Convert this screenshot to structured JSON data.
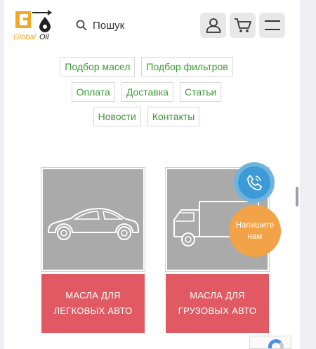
{
  "header": {
    "logo_text_a": "Global",
    "logo_text_b": "Oil",
    "search_placeholder": "Пошук"
  },
  "nav_rows": [
    [
      "Подбор масел",
      "Подбор фильтров"
    ],
    [
      "Оплата",
      "Доставка",
      "Статьи"
    ],
    [
      "Новости",
      "Контакты"
    ]
  ],
  "cards": [
    {
      "label_line1": "МАСЛА ДЛЯ",
      "label_line2": "ЛЕГКОВЫХ АВТО"
    },
    {
      "label_line1": "МАСЛА ДЛЯ",
      "label_line2": "ГРУЗОВЫХ АВТО"
    }
  ],
  "widgets": {
    "write_line1": "Напишите",
    "write_line2": "нам"
  },
  "colors": {
    "accent_green": "#3c9a34",
    "card_button": "#e15a63",
    "callback_blue": "#3c9ad6",
    "write_orange": "#f2a247",
    "logo_orange": "#f5a623"
  }
}
